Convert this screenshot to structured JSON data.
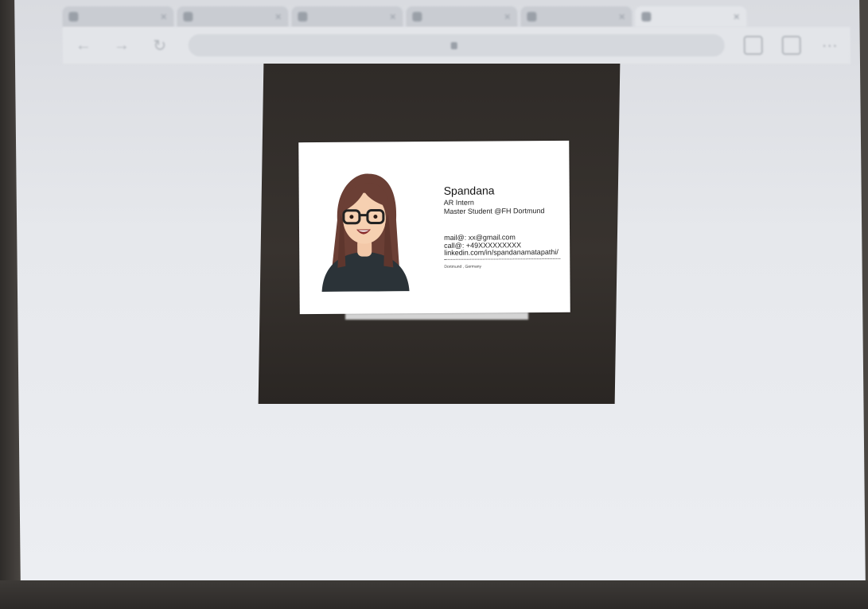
{
  "browser": {
    "tabs": [
      {
        "label": "",
        "active": false
      },
      {
        "label": "",
        "active": false
      },
      {
        "label": "",
        "active": false
      },
      {
        "label": "",
        "active": false
      },
      {
        "label": "",
        "active": false
      },
      {
        "label": "",
        "active": true
      }
    ],
    "url": "",
    "icons": [
      "back-icon",
      "forward-icon",
      "reload-icon",
      "lock-icon",
      "share-icon",
      "tabs-icon",
      "menu-icon"
    ]
  },
  "card": {
    "name": "Spandana",
    "role": "AR Intern",
    "subtitle": "Master Student @FH Dortmund",
    "email": "mail@: xx@gmail.com",
    "phone": "call@: +49XXXXXXXXX",
    "linkedin": "linkedin.com/in/spandanamatapathi/",
    "location": "Dortmund , Germany"
  },
  "colors": {
    "screen": "#e6e8ec",
    "marker": "#332f2b",
    "card": "#ffffff",
    "hair": "#6b3f35",
    "shirt": "#2b3338"
  }
}
